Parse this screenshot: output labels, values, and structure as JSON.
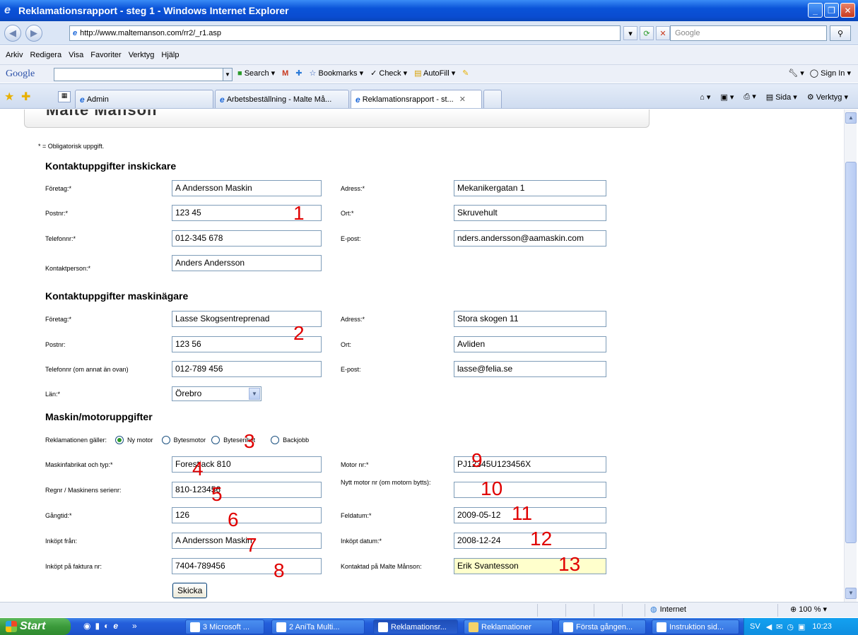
{
  "window": {
    "title": "Reklamationsrapport - steg 1 - Windows Internet Explorer",
    "min_label": "_",
    "max_label": "❐",
    "close_label": "✕"
  },
  "addressbar": {
    "url": "http://www.maltemanson.com/rr2/_r1.asp",
    "search_placeholder": "Google"
  },
  "menu": [
    "Arkiv",
    "Redigera",
    "Visa",
    "Favoriter",
    "Verktyg",
    "Hjälp"
  ],
  "google_toolbar": {
    "logo": "Google",
    "search": "Search",
    "bookmarks": "Bookmarks",
    "check": "Check",
    "autofill": "AutoFill",
    "signin": "Sign In"
  },
  "tabs": [
    {
      "label": "Admin"
    },
    {
      "label": "Arbetsbeställning - Malte Må..."
    },
    {
      "label": "Reklamationsrapport - st..."
    }
  ],
  "commandbar": {
    "page": "Sida",
    "tools": "Verktyg"
  },
  "page": {
    "logo_text": "Malte Månson",
    "required_note": "* = Obligatorisk uppgift.",
    "section1": {
      "title": "Kontaktuppgifter inskickare",
      "foretag_label": "Företag:*",
      "foretag": "A Andersson Maskin",
      "adress_label": "Adress:*",
      "adress": "Mekanikergatan 1",
      "postnr_label": "Postnr:*",
      "postnr": "123 45",
      "ort_label": "Ort:*",
      "ort": "Skruvehult",
      "telefon_label": "Telefonnr:*",
      "telefon": "012-345 678",
      "epost_label": "E-post:",
      "epost": "nders.andersson@aamaskin.com",
      "kontakt_label": "Kontaktperson:*",
      "kontakt": "Anders Andersson"
    },
    "section2": {
      "title": "Kontaktuppgifter maskinägare",
      "foretag_label": "Företag:*",
      "foretag": "Lasse Skogsentreprenad",
      "adress_label": "Adress:*",
      "adress": "Stora skogen 11",
      "postnr_label": "Postnr:",
      "postnr": "123 56",
      "ort_label": "Ort:",
      "ort": "Avliden",
      "telefon_label": "Telefonnr (om annat än ovan)",
      "telefon": "012-789 456",
      "epost_label": "E-post:",
      "epost": "lasse@felia.se",
      "lan_label": "Län:*",
      "lan": "Örebro"
    },
    "section3": {
      "title": "Maskin/motoruppgifter",
      "reklamation_label": "Reklamationen gäller:",
      "options": [
        "Ny motor",
        "Bytesmotor",
        "Bytesenhet",
        "Backjobb"
      ],
      "maskin_label": "Maskinfabrikat och typ:*",
      "maskin": "Forestjack 810",
      "motornr_label": "Motor nr:*",
      "motornr": "PJ12345U123456X",
      "regnr_label": "Regnr / Maskinens serienr:",
      "regnr": "810-123456",
      "nytt_label": "Nytt motor nr (om motorn bytts):",
      "nytt": "",
      "gangtid_label": "Gångtid:*",
      "gangtid": "126",
      "feldatum_label": "Feldatum:*",
      "feldatum": "2009-05-12",
      "inkopt_fran_label": "Inköpt från:",
      "inkopt_fran": "A Andersson Maskin",
      "inkopt_datum_label": "Inköpt datum:*",
      "inkopt_datum": "2008-12-24",
      "faktura_label": "Inköpt på faktura nr:",
      "faktura": "7404-789456",
      "kontaktad_label": "Kontaktad på Malte Månson:",
      "kontaktad": "Erik Svantesson"
    },
    "submit": "Skicka",
    "annotations": [
      "1",
      "2",
      "3",
      "4",
      "5",
      "6",
      "7",
      "8",
      "9",
      "10",
      "11",
      "12",
      "13"
    ]
  },
  "statusbar": {
    "zone": "Internet",
    "zoom": "100 %"
  },
  "taskbar": {
    "start": "Start",
    "tasks": [
      "3 Microsoft ...",
      "2 AniTa Multi...",
      "Reklamationsr...",
      "Reklamationer",
      "Första gången...",
      "Instruktion sid..."
    ],
    "lang": "SV",
    "clock": "10:23"
  },
  "colors": {
    "annotation": "#e00000",
    "highlight_field": "#ffffcc"
  }
}
